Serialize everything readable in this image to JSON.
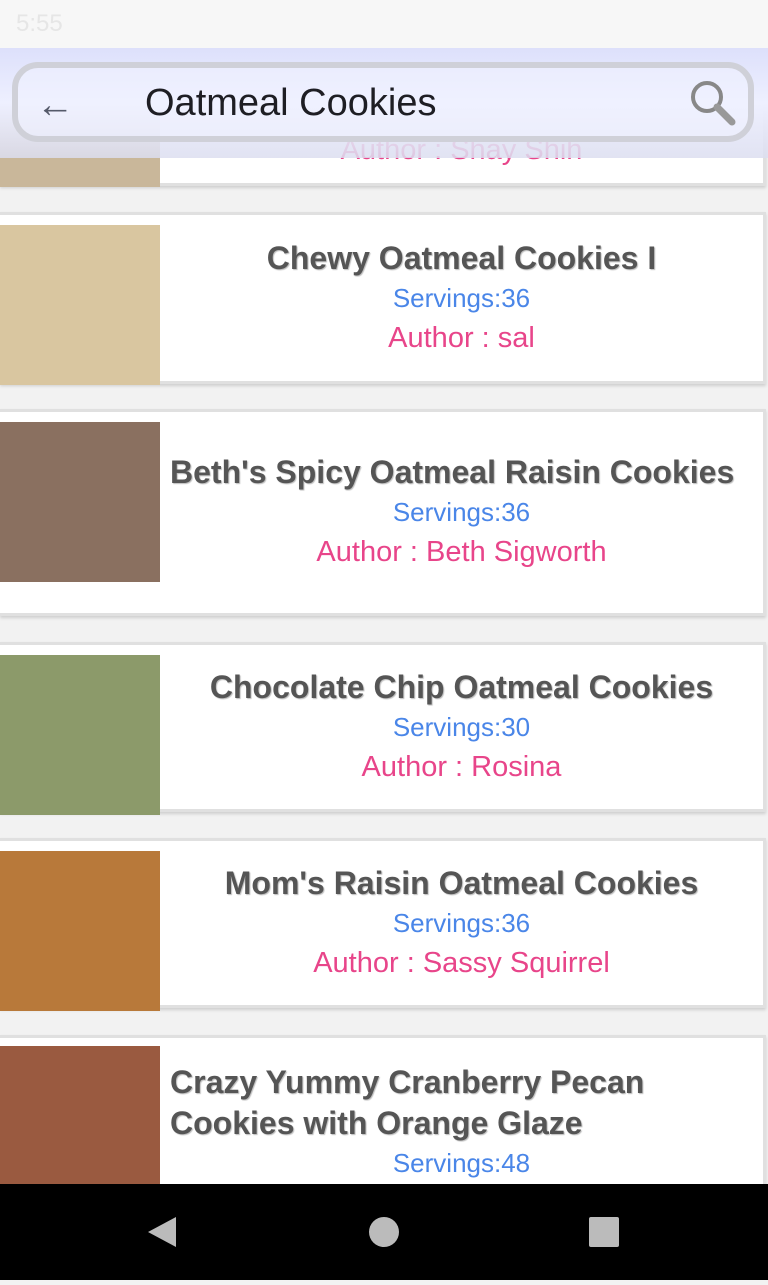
{
  "status_bar": {
    "time": "5:55"
  },
  "search": {
    "query": "Oatmeal Cookies"
  },
  "recipes": [
    {
      "title": "",
      "servings": "",
      "author": "Author : Shay Shih",
      "img": "#c9b79a"
    },
    {
      "title": "Chewy Oatmeal Cookies I",
      "servings": "Servings:36",
      "author": "Author : sal",
      "img": "#d9c6a0"
    },
    {
      "title": "Beth's Spicy Oatmeal Raisin Cookies",
      "servings": "Servings:36",
      "author": "Author : Beth Sigworth",
      "img": "#8a7060"
    },
    {
      "title": "Chocolate Chip Oatmeal Cookies",
      "servings": "Servings:30",
      "author": "Author : Rosina",
      "img": "#8c9a6a"
    },
    {
      "title": "Mom's Raisin Oatmeal Cookies",
      "servings": "Servings:36",
      "author": "Author : Sassy Squirrel",
      "img": "#b8793a"
    },
    {
      "title": "Crazy Yummy Cranberry Pecan Cookies with Orange Glaze",
      "servings": "Servings:48",
      "author": "",
      "img": "#9a5a40"
    }
  ]
}
